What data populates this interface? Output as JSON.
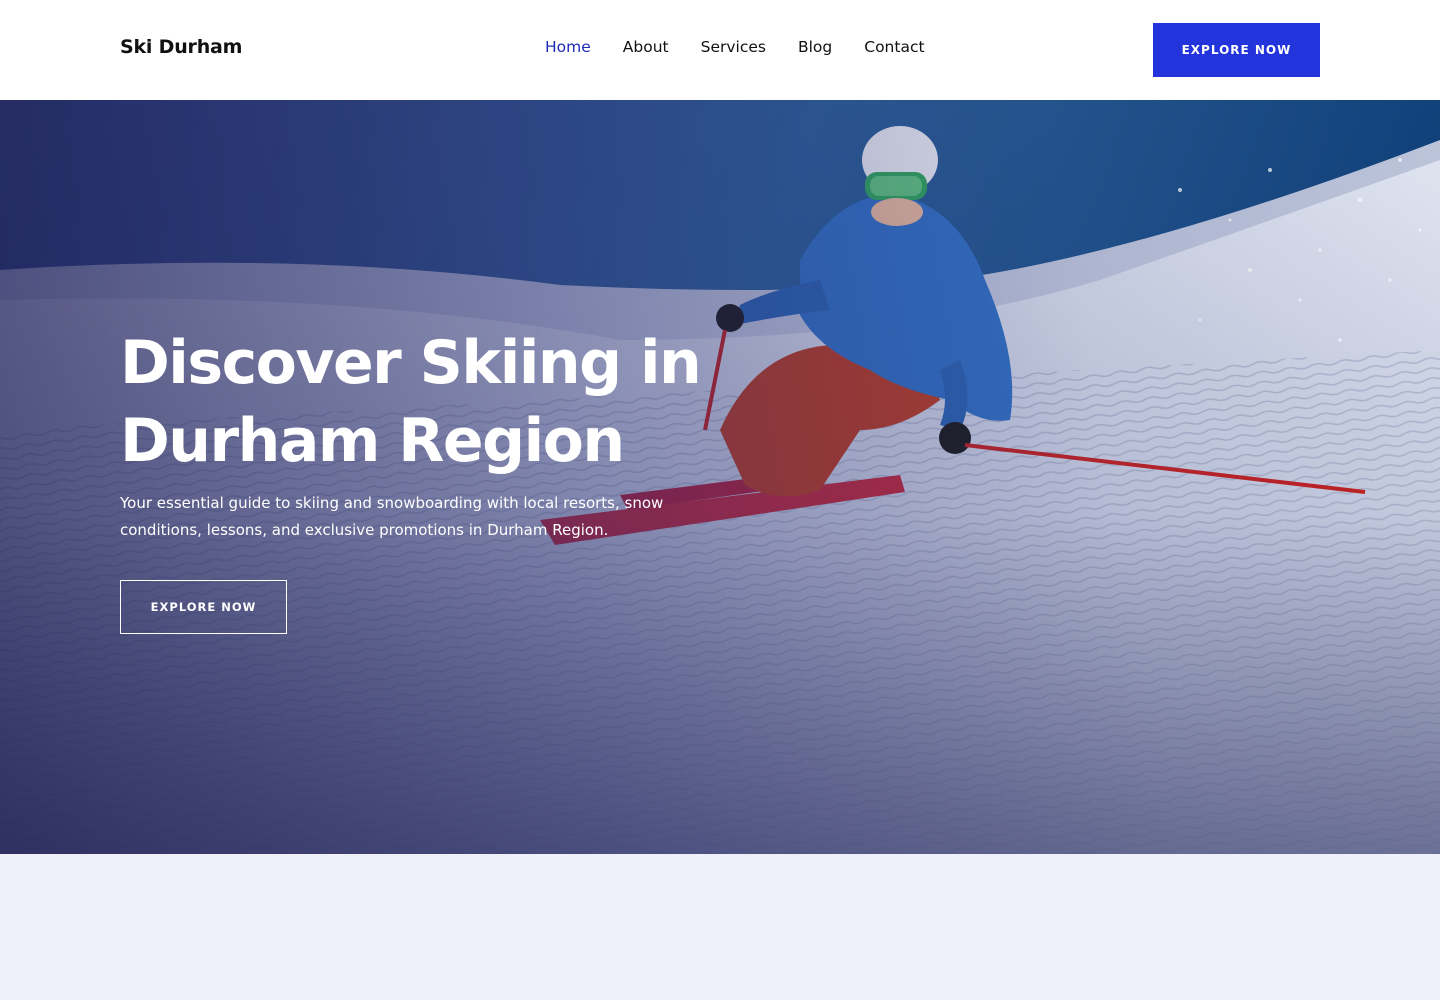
{
  "header": {
    "logo": "Ski Durham",
    "nav": [
      {
        "label": "Home",
        "active": true
      },
      {
        "label": "About",
        "active": false
      },
      {
        "label": "Services",
        "active": false
      },
      {
        "label": "Blog",
        "active": false
      },
      {
        "label": "Contact",
        "active": false
      }
    ],
    "cta_label": "EXPLORE NOW"
  },
  "hero": {
    "title": "Discover Skiing in Durham Region",
    "subtitle": "Your essential guide to skiing and snowboarding with local resorts, snow conditions, lessons, and exclusive promotions in Durham Region.",
    "cta_label": "EXPLORE NOW"
  },
  "colors": {
    "accent": "#2434dd",
    "nav_active": "#1f2bb8",
    "section_bg": "#f0f0fb"
  }
}
